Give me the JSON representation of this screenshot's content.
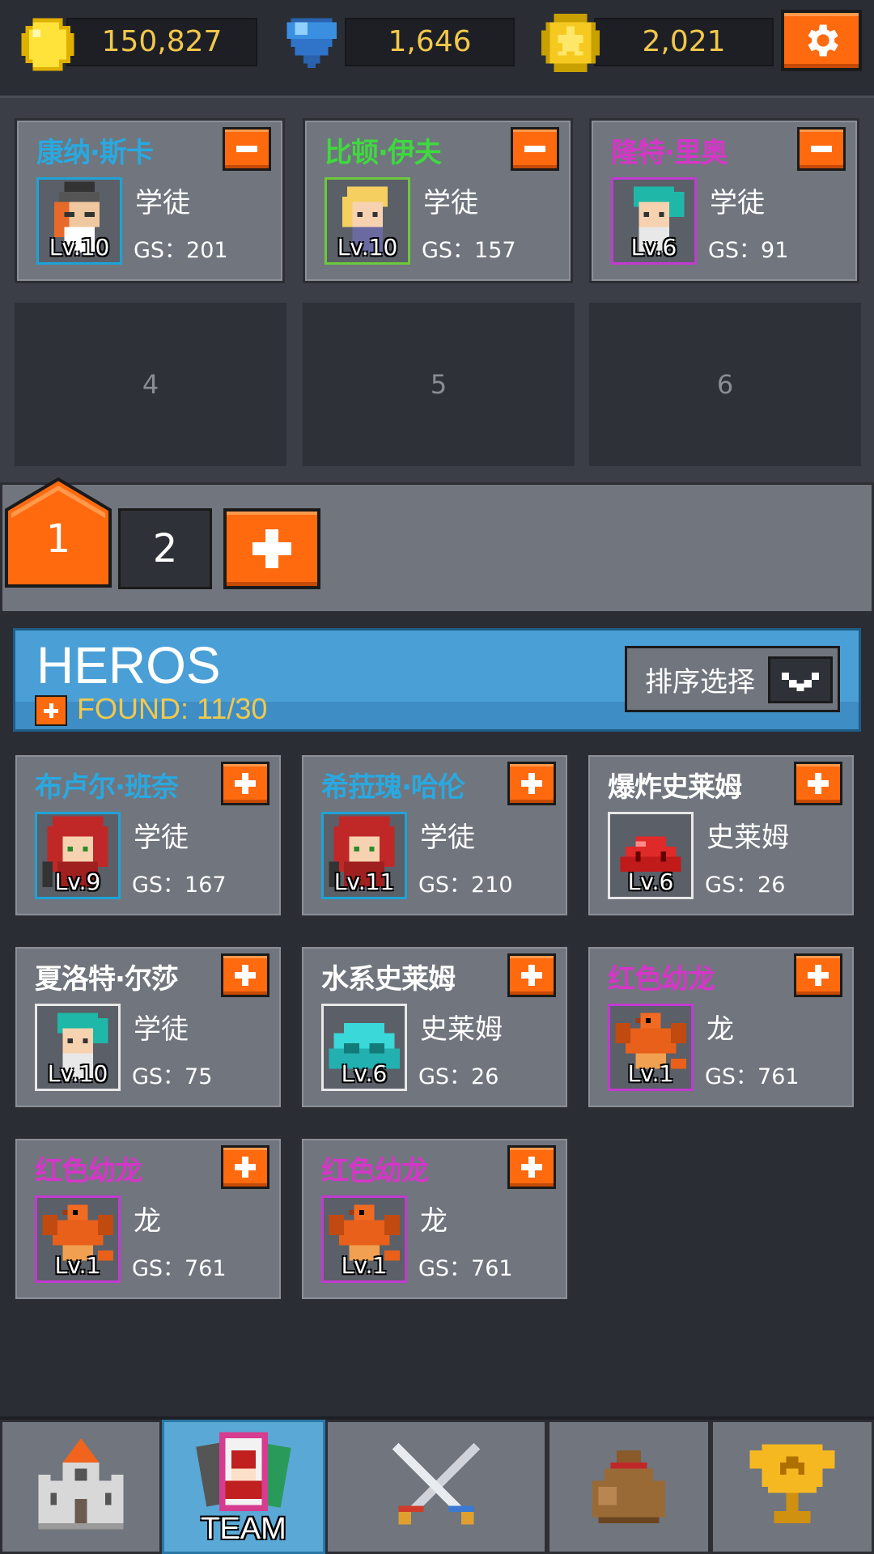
{
  "currency": {
    "gold": "150,827",
    "gems": "1,646",
    "stars": "2,021"
  },
  "team": {
    "members": [
      {
        "name": "康纳·斯卡",
        "name_color": "#29a9e0",
        "class": "学徒",
        "level": "Lv.10",
        "gs": "GS：201",
        "frame": "#1ea3d6",
        "icon": "hero-mage-icon"
      },
      {
        "name": "比顿·伊夫",
        "name_color": "#3fd93f",
        "class": "学徒",
        "level": "Lv.10",
        "gs": "GS：157",
        "frame": "#6cc93b",
        "icon": "hero-blonde-icon"
      },
      {
        "name": "隆特·里奥",
        "name_color": "#d636c8",
        "class": "学徒",
        "level": "Lv.6",
        "gs": "GS：91",
        "frame": "#c23ad0",
        "icon": "hero-teal-icon"
      }
    ],
    "empty_slots": [
      "4",
      "5",
      "6"
    ]
  },
  "pages": {
    "active": "1",
    "second": "2"
  },
  "heros": {
    "title": "HEROS",
    "found": "FOUND: 11/30",
    "sort_label": "排序选择",
    "list": [
      {
        "name": "布卢尔·班奈",
        "name_color": "#29a9e0",
        "class": "学徒",
        "level": "Lv.9",
        "gs": "GS：167",
        "frame": "#1ea3d6",
        "icon": "hero-red-hair-icon"
      },
      {
        "name": "希菈瑰·哈伦",
        "name_color": "#29a9e0",
        "class": "学徒",
        "level": "Lv.11",
        "gs": "GS：210",
        "frame": "#1ea3d6",
        "icon": "hero-red-hair-icon"
      },
      {
        "name": "爆炸史莱姆",
        "name_color": "#ffffff",
        "class": "史莱姆",
        "level": "Lv.6",
        "gs": "GS：26",
        "frame": "#e8e8e8",
        "icon": "red-slime-icon"
      },
      {
        "name": "夏洛特·尔莎",
        "name_color": "#ffffff",
        "class": "学徒",
        "level": "Lv.10",
        "gs": "GS：75",
        "frame": "#e8e8e8",
        "icon": "hero-teal-icon"
      },
      {
        "name": "水系史莱姆",
        "name_color": "#ffffff",
        "class": "史莱姆",
        "level": "Lv.6",
        "gs": "GS：26",
        "frame": "#e8e8e8",
        "icon": "water-slime-icon"
      },
      {
        "name": "红色幼龙",
        "name_color": "#d636c8",
        "class": "龙",
        "level": "Lv.1",
        "gs": "GS：761",
        "frame": "#c23ad0",
        "icon": "red-dragon-icon"
      },
      {
        "name": "红色幼龙",
        "name_color": "#d636c8",
        "class": "龙",
        "level": "Lv.1",
        "gs": "GS：761",
        "frame": "#c23ad0",
        "icon": "red-dragon-icon"
      },
      {
        "name": "红色幼龙",
        "name_color": "#d636c8",
        "class": "龙",
        "level": "Lv.1",
        "gs": "GS：761",
        "frame": "#c23ad0",
        "icon": "red-dragon-icon"
      }
    ]
  },
  "nav": {
    "team_label": "TEAM"
  }
}
